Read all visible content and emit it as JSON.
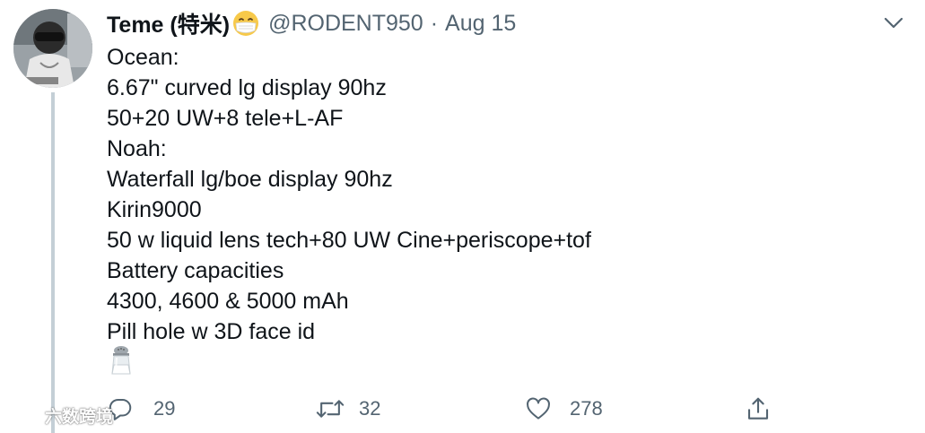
{
  "tweet": {
    "author": {
      "display_name": "Teme (特米)",
      "handle": "@RODENT950",
      "separator": "·",
      "date": "Aug 15",
      "avatar_label": "avatar photo"
    },
    "lines": [
      "Ocean:",
      "6.67\" curved lg display 90hz",
      "50+20 UW+8 tele+L-AF",
      "Noah:",
      "Waterfall lg/boe display 90hz",
      "Kirin9000",
      "50 w liquid lens tech+80 UW Cine+periscope+tof",
      "Battery capacities",
      "4300, 4600 & 5000 mAh",
      "Pill hole w 3D face id"
    ],
    "trailing_emoji": "salt-shaker",
    "actions": {
      "reply": {
        "icon": "reply-icon",
        "count": "29"
      },
      "retweet": {
        "icon": "retweet-icon",
        "count": "32"
      },
      "like": {
        "icon": "heart-icon",
        "count": "278"
      },
      "share": {
        "icon": "share-icon"
      }
    }
  },
  "watermark": {
    "text": "六数跨境"
  },
  "colors": {
    "text_primary": "#0f1419",
    "text_secondary": "#536471",
    "thread_line": "#c4cfd6",
    "mask_emoji": "#f7c94a"
  }
}
